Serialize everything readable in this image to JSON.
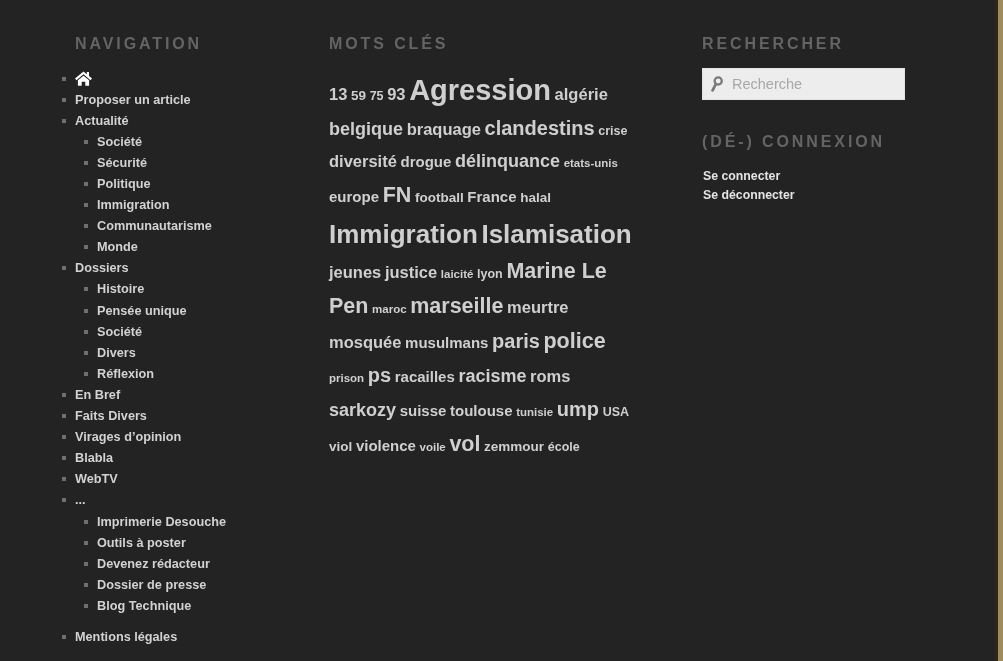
{
  "navigation": {
    "title": "NAVIGATION",
    "items": [
      {
        "kind": "home"
      },
      {
        "kind": "link",
        "label": "Proposer un article"
      },
      {
        "kind": "link",
        "label": "Actualité",
        "children": [
          {
            "kind": "link",
            "label": "Société"
          },
          {
            "kind": "link",
            "label": "Sécurité"
          },
          {
            "kind": "link",
            "label": "Politique"
          },
          {
            "kind": "link",
            "label": "Immigration"
          },
          {
            "kind": "link",
            "label": "Communautarisme"
          },
          {
            "kind": "link",
            "label": "Monde"
          }
        ]
      },
      {
        "kind": "link",
        "label": "Dossiers",
        "children": [
          {
            "kind": "link",
            "label": "Histoire"
          },
          {
            "kind": "link",
            "label": "Pensée unique"
          },
          {
            "kind": "link",
            "label": "Société"
          },
          {
            "kind": "link",
            "label": "Divers"
          },
          {
            "kind": "link",
            "label": "Réflexion"
          }
        ]
      },
      {
        "kind": "link",
        "label": "En Bref"
      },
      {
        "kind": "link",
        "label": "Faits Divers"
      },
      {
        "kind": "link",
        "label": "Virages d’opinion"
      },
      {
        "kind": "link",
        "label": "Blabla"
      },
      {
        "kind": "link",
        "label": "WebTV"
      },
      {
        "kind": "link",
        "label": "...",
        "children": [
          {
            "kind": "link",
            "label": "Imprimerie Desouche"
          },
          {
            "kind": "link",
            "label": "Outils à poster"
          },
          {
            "kind": "link",
            "label": "Devenez rédacteur"
          },
          {
            "kind": "link",
            "label": "Dossier de presse"
          },
          {
            "kind": "link",
            "label": "Blog Technique"
          }
        ]
      }
    ],
    "secondary_items": [
      {
        "kind": "link",
        "label": "Mentions légales"
      }
    ]
  },
  "tag_cloud": {
    "title": "MOTS CLÉS",
    "tags": [
      {
        "label": "13",
        "kind": "xl"
      },
      {
        "label": "59",
        "kind": "m"
      },
      {
        "label": "75",
        "kind": "s"
      },
      {
        "label": "93",
        "kind": "xl"
      },
      {
        "label": "Agression",
        "kind": "max"
      },
      {
        "label": "algérie",
        "kind": "xl"
      },
      {
        "label": "belgique",
        "kind": "xxl"
      },
      {
        "label": "braquage",
        "kind": "xl"
      },
      {
        "label": "clandestins",
        "kind": "xxxl"
      },
      {
        "label": "crise",
        "kind": "s"
      },
      {
        "label": "diversité",
        "kind": "xl"
      },
      {
        "label": "drogue",
        "kind": "l"
      },
      {
        "label": "délinquance",
        "kind": "xxl"
      },
      {
        "label": "etats-unis",
        "kind": "xs"
      },
      {
        "label": "europe",
        "kind": "l"
      },
      {
        "label": "FN",
        "kind": "huge"
      },
      {
        "label": "football",
        "kind": "m"
      },
      {
        "label": "France",
        "kind": "l"
      },
      {
        "label": "halal",
        "kind": "m"
      },
      {
        "label": "Immigration",
        "kind": "giant"
      },
      {
        "label": "Islamisation",
        "kind": "giant"
      },
      {
        "label": "jeunes",
        "kind": "xl"
      },
      {
        "label": "justice",
        "kind": "xl"
      },
      {
        "label": "laicité",
        "kind": "xs"
      },
      {
        "label": "lyon",
        "kind": "s"
      },
      {
        "label": "Marine Le Pen",
        "kind": "huge"
      },
      {
        "label": "maroc",
        "kind": "xs"
      },
      {
        "label": "marseille",
        "kind": "huge"
      },
      {
        "label": "meurtre",
        "kind": "xl"
      },
      {
        "label": "mosquée",
        "kind": "xl"
      },
      {
        "label": "musulmans",
        "kind": "l"
      },
      {
        "label": "paris",
        "kind": "xxxl"
      },
      {
        "label": "police",
        "kind": "huge"
      },
      {
        "label": "prison",
        "kind": "xs"
      },
      {
        "label": "ps",
        "kind": "xxxl"
      },
      {
        "label": "racailles",
        "kind": "l"
      },
      {
        "label": "racisme",
        "kind": "xxl"
      },
      {
        "label": "roms",
        "kind": "xl"
      },
      {
        "label": "sarkozy",
        "kind": "xxl"
      },
      {
        "label": "suisse",
        "kind": "l"
      },
      {
        "label": "toulouse",
        "kind": "l"
      },
      {
        "label": "tunisie",
        "kind": "xs"
      },
      {
        "label": "ump",
        "kind": "xxxl"
      },
      {
        "label": "USA",
        "kind": "s"
      },
      {
        "label": "viol",
        "kind": "m"
      },
      {
        "label": "violence",
        "kind": "l"
      },
      {
        "label": "voile",
        "kind": "xs"
      },
      {
        "label": "vol",
        "kind": "huge"
      },
      {
        "label": "zemmour",
        "kind": "m"
      },
      {
        "label": "école",
        "kind": "s"
      }
    ]
  },
  "search": {
    "title": "RECHERCHER",
    "placeholder": "Recherche"
  },
  "login": {
    "title": "(DÉ-) CONNEXION",
    "links": [
      {
        "label": "Se connecter"
      },
      {
        "label": "Se déconnecter"
      }
    ]
  }
}
